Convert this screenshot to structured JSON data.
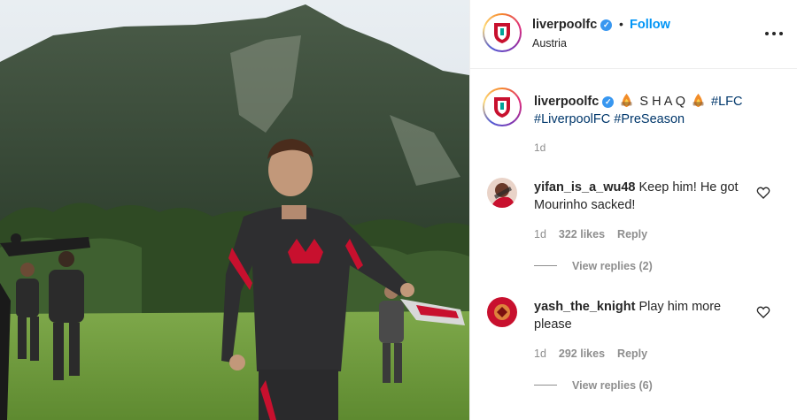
{
  "post": {
    "username": "liverpoolfc",
    "follow_label": "Follow",
    "dot": "•",
    "location": "Austria",
    "verified_mark": "✓",
    "more_icon": "more-horizontal-icon"
  },
  "caption": {
    "username": "liverpoolfc",
    "text": " S H A Q ",
    "tag1": "#LFC",
    "tag2": "#LiverpoolFC",
    "tag3": "#PreSeason",
    "time": "1d",
    "emoji_icon": "fire-emoji-icon"
  },
  "comments": [
    {
      "username": "yifan_is_a_wu48",
      "text": "Keep him! He got Mourinho sacked!",
      "time": "1d",
      "likes": "322 likes",
      "reply_label": "Reply",
      "view_replies": "View replies (2)"
    },
    {
      "username": "yash_the_knight",
      "text": "Play him more please",
      "time": "1d",
      "likes": "292 likes",
      "reply_label": "Reply",
      "view_replies": "View replies (6)"
    }
  ],
  "colors": {
    "accent": "#0095f6",
    "hashtag": "#00376b",
    "muted": "#8e8e8e",
    "lfc_red": "#c8102e"
  }
}
